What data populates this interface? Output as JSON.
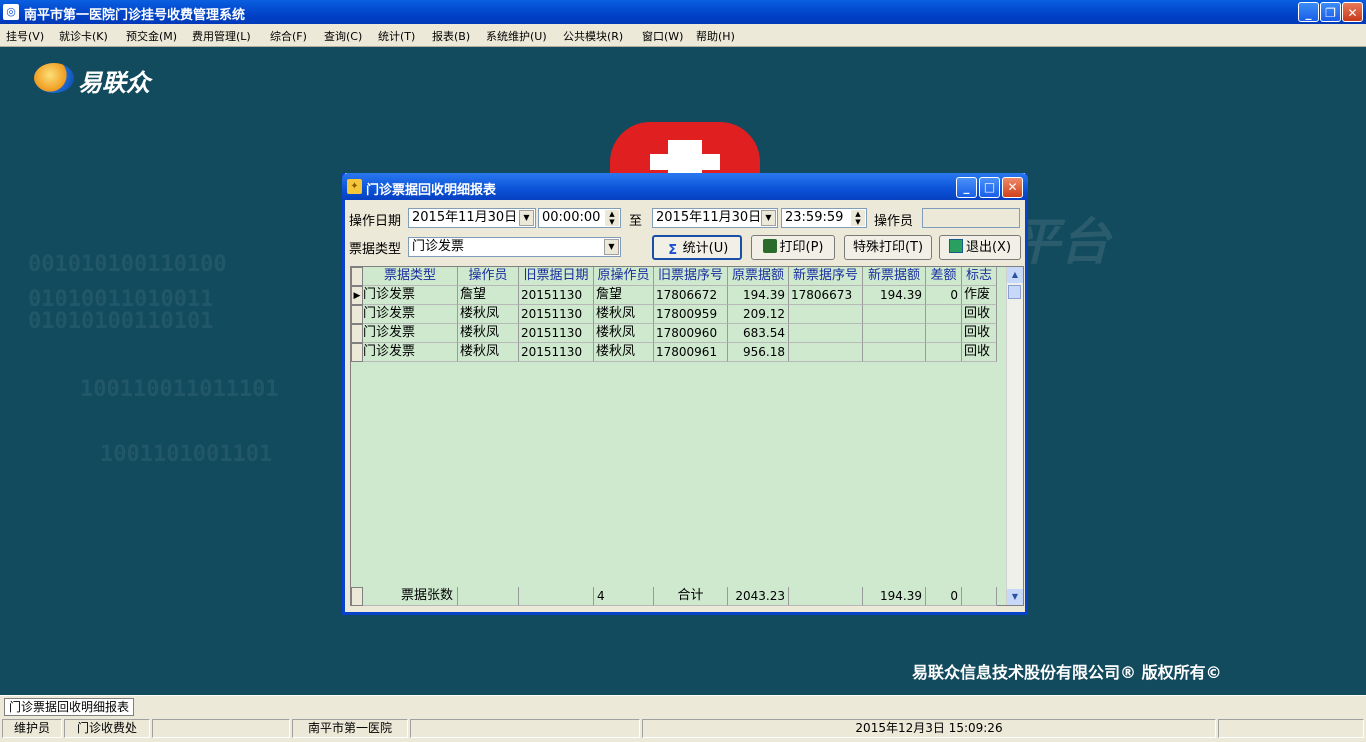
{
  "window": {
    "title": "南平市第一医院门诊挂号收费管理系统"
  },
  "menu": [
    "挂号(V)",
    "就诊卡(K)",
    "预交金(M)",
    "费用管理(L)",
    "综合(F)",
    "查询(C)",
    "统计(T)",
    "报表(B)",
    "系统维护(U)",
    "公共模块(R)",
    "窗口(W)",
    "帮助(H)"
  ],
  "desktop": {
    "logo_text": "易联众",
    "copyright": "易联众信息技术股份有限公司® 版权所有©",
    "binary_lines": [
      "001010100110100",
      "01010011010011",
      "01010100110101",
      "100110011011101",
      "1001101001101"
    ]
  },
  "dialog": {
    "title": "门诊票据回收明细报表",
    "op_date_label": "操作日期",
    "date_from": "2015年11月30日",
    "time_from": "00:00:00",
    "to_label": "至",
    "date_to": "2015年11月30日",
    "time_to": "23:59:59",
    "operator_label": "操作员",
    "operator_value": "",
    "ticket_type_label": "票据类型",
    "ticket_type_value": "门诊发票",
    "btn_stat": "统计(U)",
    "btn_print": "打印(P)",
    "btn_special_print": "特殊打印(T)",
    "btn_exit": "退出(X)",
    "columns": [
      "票据类型",
      "操作员",
      "旧票据日期",
      "原操作员",
      "旧票据序号",
      "原票据额",
      "新票据序号",
      "新票据额",
      "差额",
      "标志"
    ],
    "rows": [
      [
        "门诊发票",
        "詹望",
        "20151130",
        "詹望",
        "17806672",
        "194.39",
        "17806673",
        "194.39",
        "0",
        "作废"
      ],
      [
        "门诊发票",
        "楼秋凤",
        "20151130",
        "楼秋凤",
        "17800959",
        "209.12",
        "",
        "",
        "",
        "回收"
      ],
      [
        "门诊发票",
        "楼秋凤",
        "20151130",
        "楼秋凤",
        "17800960",
        "683.54",
        "",
        "",
        "",
        "回收"
      ],
      [
        "门诊发票",
        "楼秋凤",
        "20151130",
        "楼秋凤",
        "17800961",
        "956.18",
        "",
        "",
        "",
        "回收"
      ]
    ],
    "footer": [
      "票据张数",
      "",
      "",
      "4",
      "合计",
      "2043.23",
      "",
      "194.39",
      "0",
      ""
    ]
  },
  "taskbar": {
    "tab": "门诊票据回收明细报表"
  },
  "status": [
    "维护员",
    "门诊收费处",
    "",
    "南平市第一医院",
    "",
    "2015年12月3日 15:09:26",
    ""
  ]
}
